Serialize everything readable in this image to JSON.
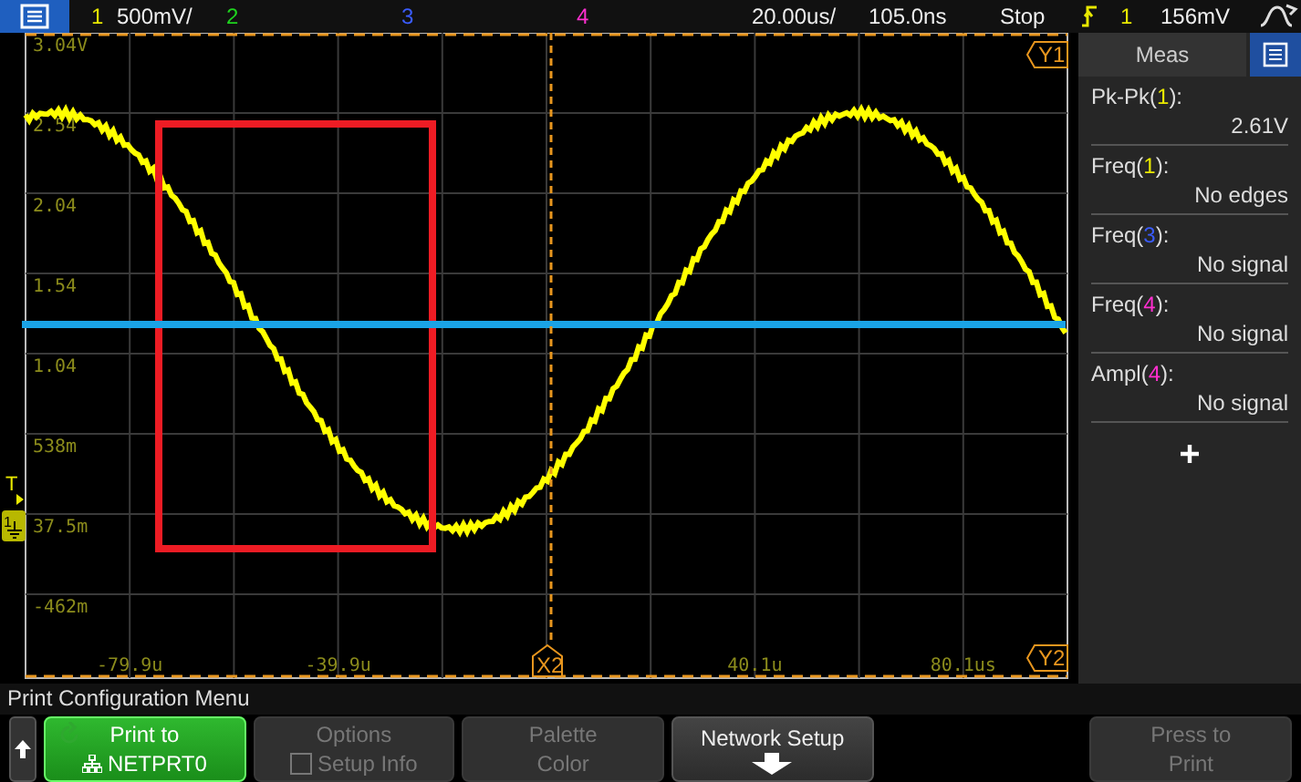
{
  "top_bar": {
    "channels": [
      {
        "label": "1",
        "color": "#e8e800",
        "scale": "500mV/"
      },
      {
        "label": "2",
        "color": "#1fd41f"
      },
      {
        "label": "3",
        "color": "#3a5cff"
      },
      {
        "label": "4",
        "color": "#ff2fd0"
      }
    ],
    "timebase": "20.00us/",
    "delay": "105.0ns",
    "run_state": "Stop",
    "trigger": {
      "source": "1",
      "level": "156mV"
    }
  },
  "graph": {
    "y_labels": [
      "3.04V",
      "2.54",
      "2.04",
      "1.54",
      "1.04",
      "538m",
      "37.5m",
      "-462m"
    ],
    "x_labels": [
      "-79.9u",
      "-39.9u",
      "40.1u",
      "80.1us"
    ],
    "markers": {
      "y1": "Y1",
      "y2": "Y2",
      "x2": "X2",
      "trigger": "T",
      "ground": "1"
    }
  },
  "measurements": {
    "title": "Meas",
    "items": [
      {
        "before": "Pk-Pk(",
        "channel": "1",
        "after": "):",
        "color": "#e8e800",
        "value": "2.61V"
      },
      {
        "before": "Freq(",
        "channel": "1",
        "after": "):",
        "color": "#e8e800",
        "value": "No edges"
      },
      {
        "before": "Freq(",
        "channel": "3",
        "after": "):",
        "color": "#3a5cff",
        "value": "No signal"
      },
      {
        "before": "Freq(",
        "channel": "4",
        "after": "):",
        "color": "#ff2fd0",
        "value": "No signal"
      },
      {
        "before": "Ampl(",
        "channel": "4",
        "after": "):",
        "color": "#ff2fd0",
        "value": "No signal"
      }
    ]
  },
  "menu": {
    "title": "Print Configuration Menu",
    "buttons": [
      {
        "kind": "back"
      },
      {
        "kind": "print_to",
        "lines": [
          "Print to",
          "NETPRT0"
        ],
        "selected": true,
        "disabled": false
      },
      {
        "kind": "checkbox",
        "lines": [
          "Options",
          "Setup Info"
        ],
        "checked": false,
        "disabled": true
      },
      {
        "kind": "text",
        "lines": [
          "Palette",
          "Color"
        ],
        "disabled": true
      },
      {
        "kind": "submenu",
        "lines": [
          "Network Setup"
        ],
        "disabled": false
      },
      {
        "kind": "spacer"
      },
      {
        "kind": "text",
        "lines": [
          "Press to",
          "Print"
        ],
        "disabled": true
      }
    ]
  }
}
